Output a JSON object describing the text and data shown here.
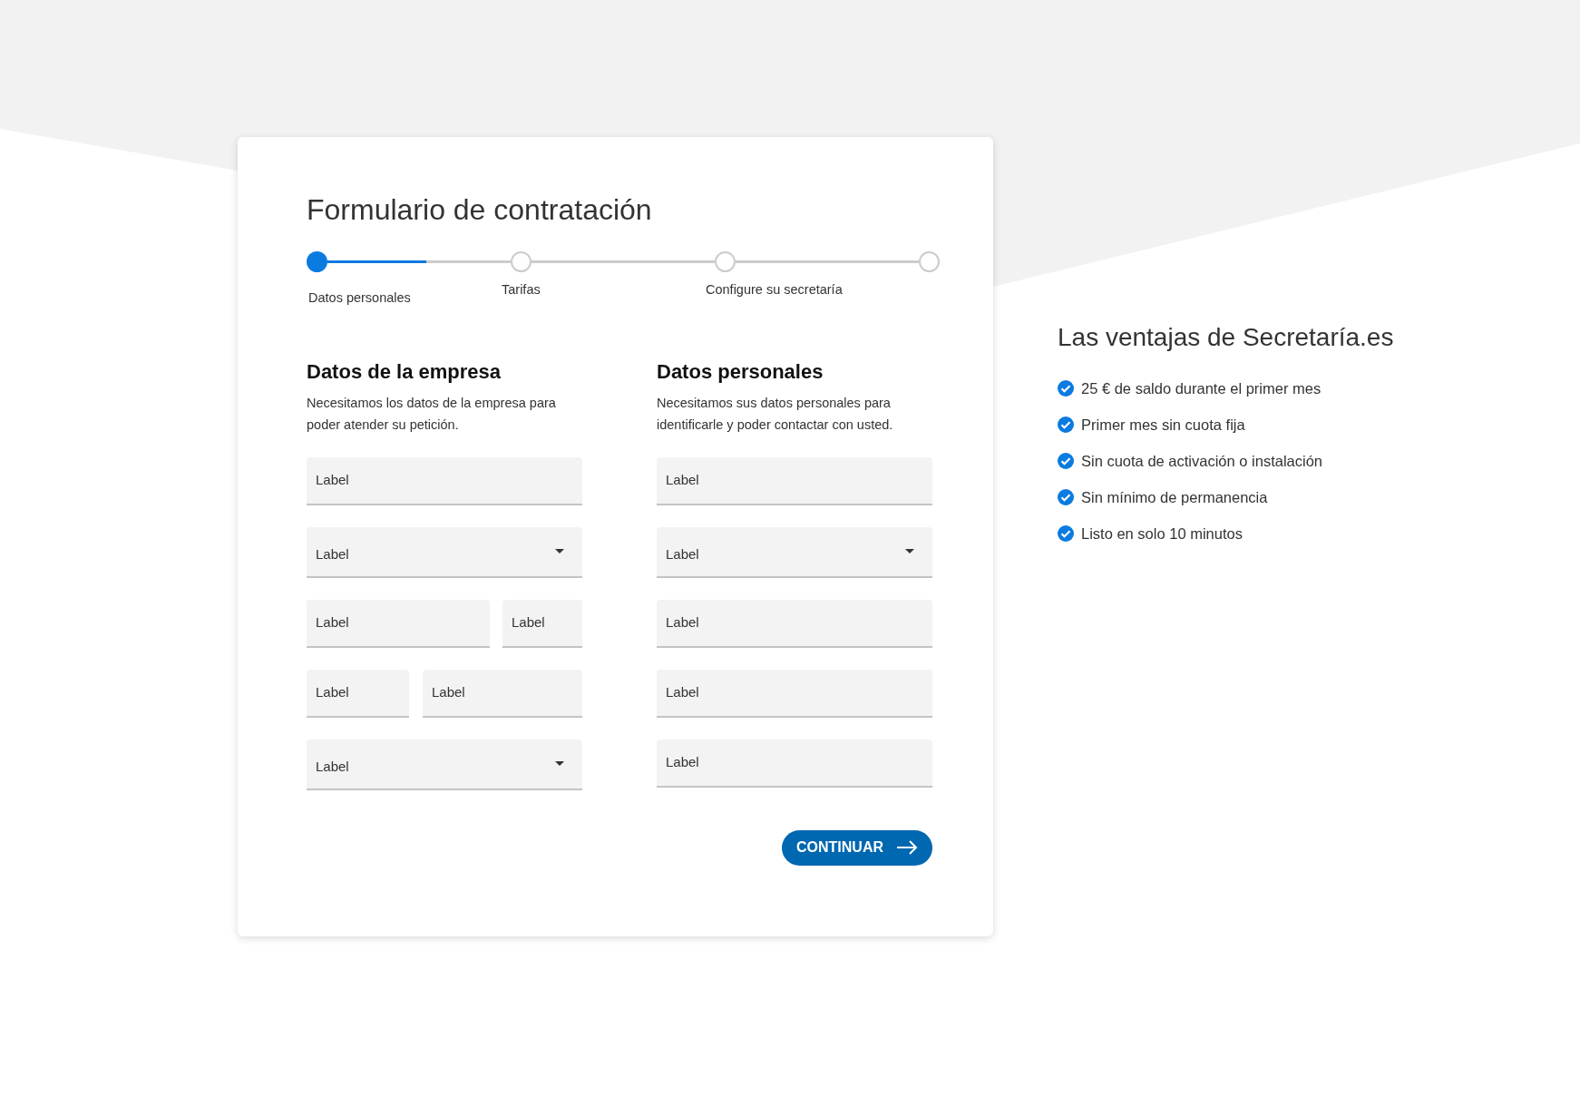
{
  "form": {
    "title": "Formulario de contratación",
    "steps": [
      {
        "label": "Datos personales",
        "selected": true,
        "level": 0.54
      },
      {
        "label": "Tarifas",
        "selected": false
      },
      {
        "label": "Configure su secretaría",
        "selected": false
      },
      {
        "selected": false
      }
    ],
    "sections": [
      {
        "heading": "Datos de la empresa",
        "description": "Necesitamos los datos de la empresa para poder atender su petición.",
        "rows": [
          [
            {
              "kind": "text",
              "placeholder": "Label"
            }
          ],
          [
            {
              "kind": "select",
              "placeholder": "Label"
            }
          ],
          [
            {
              "kind": "text",
              "placeholder": "Label"
            },
            {
              "kind": "text",
              "placeholder": "Label"
            }
          ],
          [
            {
              "kind": "text",
              "placeholder": "Label"
            },
            {
              "kind": "text",
              "placeholder": "Label"
            }
          ],
          [
            {
              "kind": "select",
              "placeholder": "Label"
            }
          ]
        ]
      },
      {
        "heading": "Datos personales",
        "description": "Necesitamos sus datos personales para identificarle y poder contactar con usted.",
        "rows": [
          [
            {
              "kind": "text",
              "placeholder": "Label"
            }
          ],
          [
            {
              "kind": "select",
              "placeholder": "Label"
            }
          ],
          [
            {
              "kind": "text",
              "placeholder": "Label"
            }
          ],
          [
            {
              "kind": "text",
              "placeholder": "Label"
            }
          ],
          [
            {
              "kind": "text",
              "placeholder": "Label"
            }
          ]
        ]
      }
    ],
    "button": "CONTINUAR"
  },
  "benefits": {
    "title": "Las ventajas de Secretaría.es",
    "items": [
      "25 € de saldo durante el primer mes",
      "Primer mes sin cuota fija",
      "Sin cuota de activación o instalación",
      "Sin mínimo de permanencia",
      "Listo en solo 10 minutos"
    ]
  }
}
